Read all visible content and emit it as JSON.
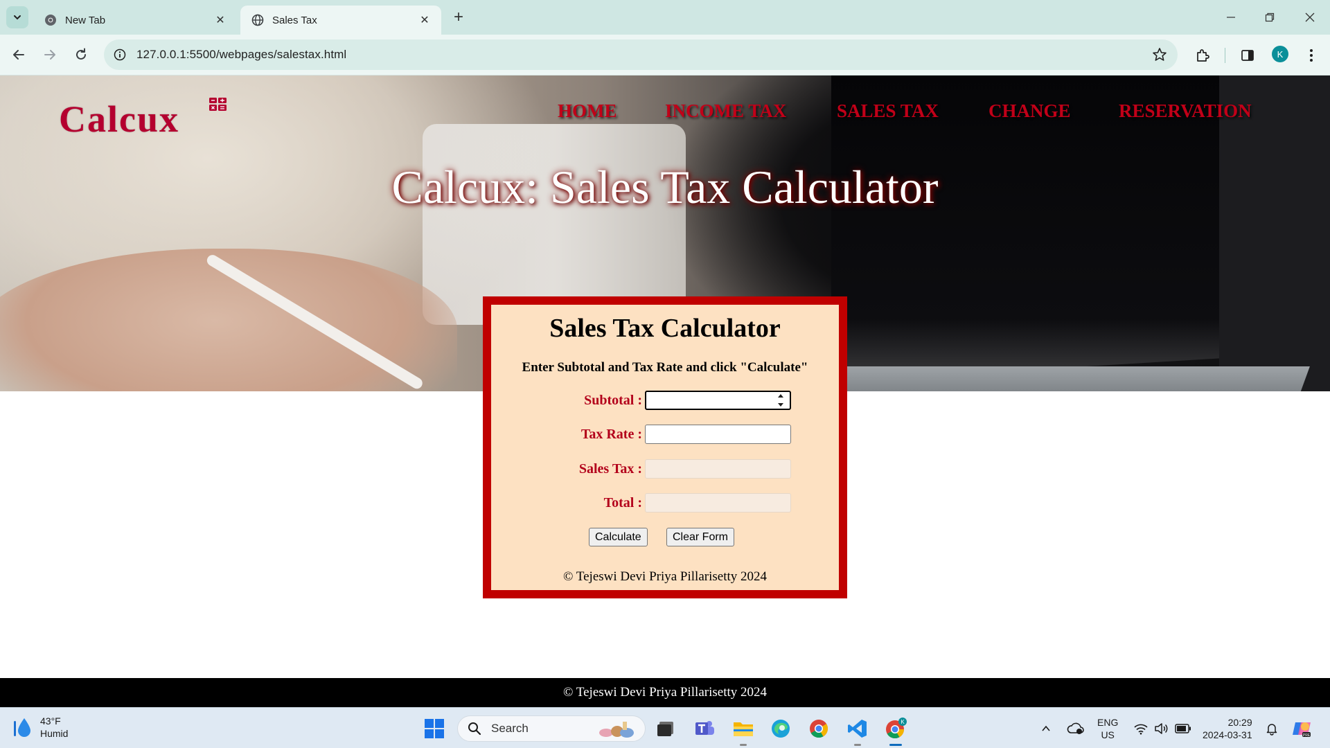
{
  "browser": {
    "tabs": [
      {
        "title": "New Tab",
        "active": false
      },
      {
        "title": "Sales Tax",
        "active": true
      }
    ],
    "url": "127.0.0.1:5500/webpages/salestax.html",
    "profile_initial": "K"
  },
  "site": {
    "logo_text": "Calcux",
    "nav": [
      "HOME",
      "INCOME TAX",
      "SALES TAX",
      "CHANGE",
      "RESERVATION"
    ],
    "hero_title": "Calcux: Sales Tax Calculator",
    "accent_color": "#c10018",
    "form": {
      "title": "Sales Tax Calculator",
      "instructions": "Enter Subtotal and Tax Rate and click \"Calculate\"",
      "fields": [
        {
          "label": "Subtotal :",
          "value": "",
          "readonly": false
        },
        {
          "label": "Tax Rate :",
          "value": "",
          "readonly": false
        },
        {
          "label": "Sales Tax :",
          "value": "",
          "readonly": true
        },
        {
          "label": "Total :",
          "value": "",
          "readonly": true
        }
      ],
      "buttons": {
        "calculate": "Calculate",
        "clear": "Clear Form"
      },
      "copyright": "© Tejeswi Devi Priya Pillarisetty 2024"
    },
    "footer": "©  Tejeswi Devi Priya Pillarisetty 2024"
  },
  "taskbar": {
    "weather": {
      "temp": "43°F",
      "condition": "Humid"
    },
    "search_label": "Search",
    "language": {
      "lang": "ENG",
      "region": "US"
    },
    "clock": {
      "time": "20:29",
      "date": "2024-03-31"
    }
  }
}
